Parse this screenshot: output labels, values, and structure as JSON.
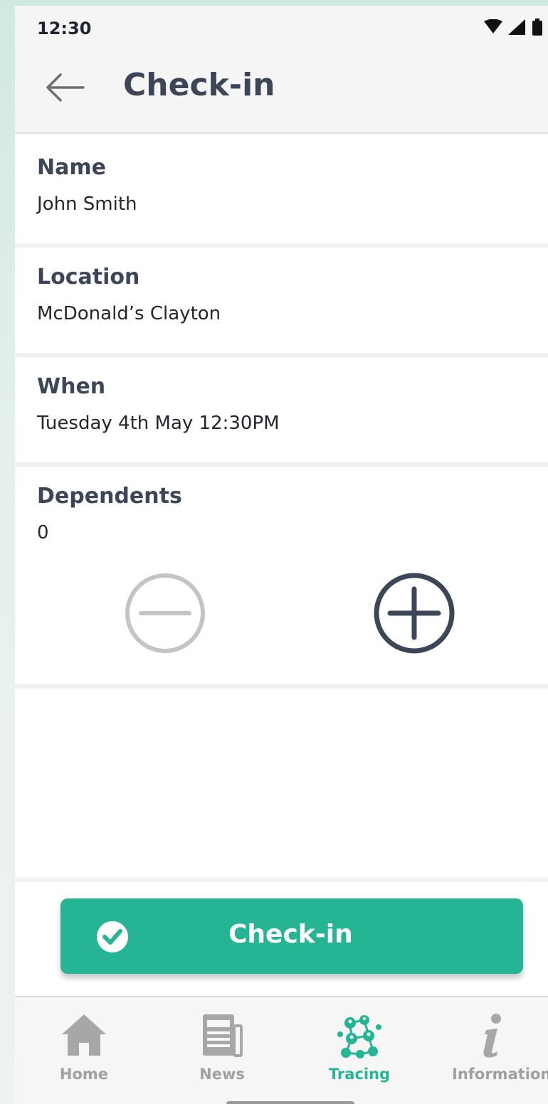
{
  "status_bar": {
    "time": "12:30"
  },
  "app_bar": {
    "title": "Check-in"
  },
  "fields": {
    "name": {
      "label": "Name",
      "value": "John Smith"
    },
    "location": {
      "label": "Location",
      "value": "McDonald’s Clayton"
    },
    "when": {
      "label": "When",
      "value": "Tuesday 4th May 12:30PM"
    },
    "dependents": {
      "label": "Dependents",
      "value": "0"
    }
  },
  "checkin_button": {
    "label": "Check-in"
  },
  "bottom_nav": {
    "items": [
      {
        "label": "Home",
        "icon": "home-icon"
      },
      {
        "label": "News",
        "icon": "newspaper-icon"
      },
      {
        "label": "Tracing",
        "icon": "tracing-network-icon",
        "active": true
      },
      {
        "label": "Information",
        "icon": "info-icon"
      }
    ]
  },
  "colors": {
    "accent": "#25b594",
    "text_heading": "#3c4656",
    "inactive": "#a0a0a0"
  }
}
